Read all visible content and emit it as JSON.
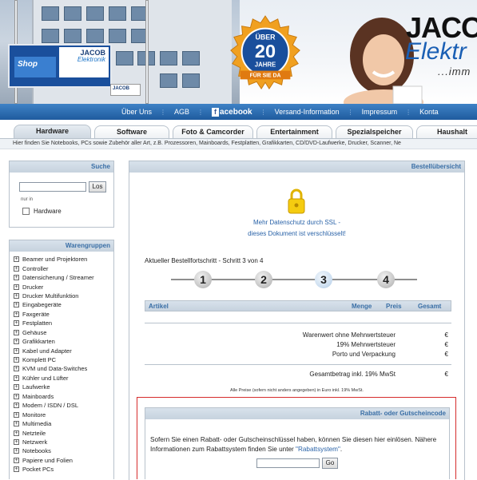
{
  "header": {
    "logo_main": "JACOB",
    "logo_sub": "Elektr",
    "slogan": "...imm",
    "badge_top": "ÜBER",
    "badge_number": "20",
    "badge_unit": "JAHRE",
    "badge_ribbon": "FÜR SIE DA",
    "billboard_logo": "JACOB",
    "billboard_logo_sub": "Elektronik",
    "billboard_shop": "Shop",
    "sign_logo": "JACOB"
  },
  "topnav": {
    "items": [
      "Über Uns",
      "AGB",
      "acebook",
      "Versand-Information",
      "Impressum",
      "Konta"
    ],
    "facebook_letter": "f"
  },
  "tabs": [
    "Hardware",
    "Software",
    "Foto & Camcorder",
    "Entertainment",
    "Spezialspeicher",
    "Haushalt"
  ],
  "tab_description": "Hier finden Sie Notebooks, PCs sowie Zubehör aller Art, z.B. Prozessoren, Mainboards, Festplatten, Grafikkarten, CD/DVD-Laufwerke, Drucker, Scanner, Ne",
  "search": {
    "title": "Suche",
    "button": "Los",
    "scope_label": "nur in",
    "scope_option": "Hardware"
  },
  "warengruppen": {
    "title": "Warengruppen",
    "items": [
      "Beamer und Projektoren",
      "Controller",
      "Datensicherung / Streamer",
      "Drucker",
      "Drucker Multifunktion",
      "Eingabegeräte",
      "Faxgeräte",
      "Festplatten",
      "Gehäuse",
      "Grafikkarten",
      "Kabel und Adapter",
      "Komplett PC",
      "KVM und Data-Switches",
      "Kühler und Lüfter",
      "Laufwerke",
      "Mainboards",
      "Modem / ISDN / DSL",
      "Monitore",
      "Multimedia",
      "Netzteile",
      "Netzwerk",
      "Notebooks",
      "Papiere und Folien",
      "Pocket PCs"
    ]
  },
  "main": {
    "title": "Bestellübersicht",
    "ssl_line1": "Mehr Datenschutz durch SSL -",
    "ssl_line2": "dieses Dokument ist verschlüsselt!",
    "progress_label": "Aktueller Bestellfortschritt - Schritt 3 von 4",
    "steps": [
      "1",
      "2",
      "3",
      "4"
    ],
    "current_step": 3,
    "cart_columns": [
      "Artikel",
      "Menge",
      "Preis",
      "Gesamt"
    ],
    "summary": [
      {
        "label": "Warenwert ohne Mehrwertsteuer",
        "currency": "€"
      },
      {
        "label": "19% Mehrwertsteuer",
        "currency": "€"
      },
      {
        "label": "Porto und Verpackung",
        "currency": "€"
      }
    ],
    "total": {
      "label": "Gesamtbetrag inkl. 19% MwSt",
      "currency": "€"
    },
    "vat_note": "Alle Preise (sofern nicht anders angegeben) in Euro inkl. 19% MwSt."
  },
  "coupon": {
    "title": "Rabatt- oder Gutscheincode",
    "text_before": "Sofern Sie einen Rabatt- oder Gutscheinschlüssel haben, können Sie diesen hier einlösen. Nähere Informationen zum Rabattsystem finden Sie unter ",
    "link_text": "\"Rabattsystem\"",
    "text_after": ".",
    "button": "Go"
  }
}
